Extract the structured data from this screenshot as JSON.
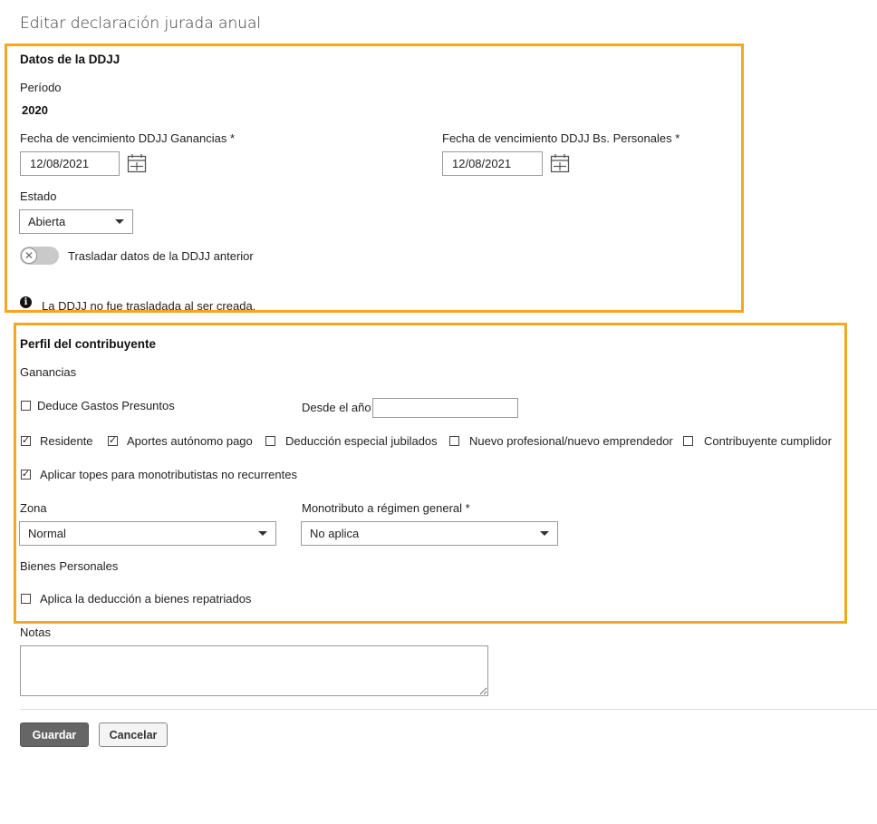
{
  "page": {
    "title": "Editar declaración jurada anual"
  },
  "ddjj": {
    "heading": "Datos de la DDJJ",
    "period_label": "Período",
    "period_value": "2020",
    "ganancias_label": "Fecha de vencimiento DDJJ Ganancias *",
    "ganancias_date": "12/08/2021",
    "bienes_label": "Fecha de vencimiento DDJJ Bs. Personales *",
    "bienes_date": "12/08/2021",
    "estado_label": "Estado",
    "estado_value": "Abierta",
    "toggle_label": "Trasladar datos de la DDJJ anterior",
    "toggle_on": false,
    "info_text": "La DDJJ no fue trasladada al ser creada."
  },
  "perfil": {
    "heading": "Perfil del contribuyente",
    "ganancias_section": "Ganancias",
    "deduce_label": "Deduce Gastos Presuntos",
    "desde_label": "Desde el año",
    "desde_value": "",
    "checks": [
      {
        "label": "Residente",
        "checked": true
      },
      {
        "label": "Aportes autónomo pago",
        "checked": true
      },
      {
        "label": "Deducción especial jubilados",
        "checked": false
      },
      {
        "label": "Nuevo profesional/nuevo emprendedor",
        "checked": false
      },
      {
        "label": "Contribuyente cumplidor",
        "checked": false
      }
    ],
    "topes_label": "Aplicar topes para monotributistas no recurrentes",
    "topes_checked": true,
    "zona_label": "Zona",
    "zona_value": "Normal",
    "mono_label": "Monotributo a régimen general *",
    "mono_value": "No aplica",
    "bienes_section": "Bienes Personales",
    "repatriados_label": "Aplica la deducción a bienes repatriados",
    "repatriados_checked": false
  },
  "notas": {
    "label": "Notas",
    "value": ""
  },
  "actions": {
    "save": "Guardar",
    "cancel": "Cancelar"
  }
}
